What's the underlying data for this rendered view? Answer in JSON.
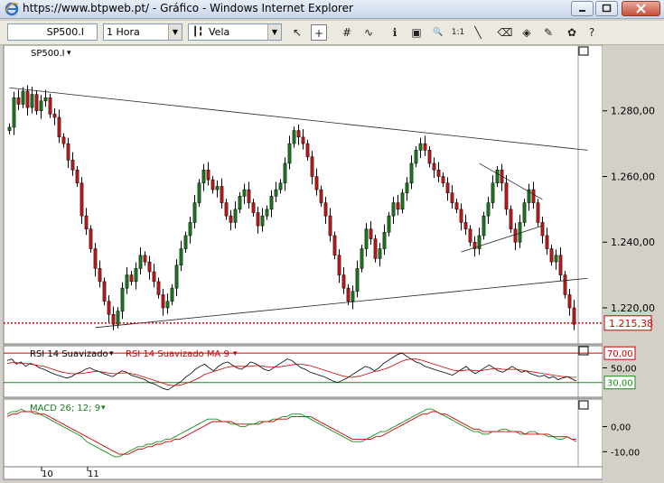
{
  "window": {
    "title": "https://www.btpweb.pt/ - Gráfico - Windows Internet Explorer"
  },
  "toolbar": {
    "symbol": "SP500.I",
    "interval": "1 Hora",
    "chart_style": "Vela",
    "tools": [
      {
        "name": "pointer-tool-icon",
        "glyph": "↖"
      },
      {
        "name": "crosshair-tool-icon",
        "glyph": "+"
      },
      {
        "name": "grid-tool-icon",
        "glyph": "#"
      },
      {
        "name": "indicator-tool-icon",
        "glyph": "∿"
      },
      {
        "name": "info-tool-icon",
        "glyph": "ℹ"
      },
      {
        "name": "chart-window-icon",
        "glyph": "▣"
      },
      {
        "name": "zoom-tool-icon",
        "glyph": "🔍"
      },
      {
        "name": "reset-zoom-icon",
        "glyph": "1:1"
      },
      {
        "name": "trendline-tool-icon",
        "glyph": "╲"
      },
      {
        "name": "eraser-tool-icon",
        "glyph": "⌫"
      },
      {
        "name": "fill-tool-icon",
        "glyph": "◈"
      },
      {
        "name": "magic-tool-icon",
        "glyph": "✎"
      },
      {
        "name": "palette-tool-icon",
        "glyph": "✿"
      },
      {
        "name": "help-icon",
        "glyph": "?"
      }
    ]
  },
  "colors": {
    "up_candle": "#1a7a1a",
    "down_candle": "#c01818",
    "support_line": "#cc0000",
    "rsi_line": "#000000",
    "rsi_ma_line": "#cc0000",
    "macd_line": "#1a8a1a",
    "signal_line": "#cc0000"
  },
  "chart_data": [
    {
      "type": "candlestick",
      "legend": "SP500.I",
      "y_ticks": [
        "1.280,00",
        "1.260,00",
        "1.240,00",
        "1.220,00"
      ],
      "ylim": [
        1209,
        1300
      ],
      "last_price_label": "1.215,38",
      "last_price": 1215.38,
      "x_ticks": [
        "10",
        "11"
      ],
      "close_path": [
        1275,
        1284,
        1282,
        1286,
        1281,
        1285,
        1280,
        1283,
        1284,
        1279,
        1278,
        1272,
        1270,
        1265,
        1262,
        1258,
        1248,
        1244,
        1238,
        1232,
        1228,
        1222,
        1218,
        1215,
        1219,
        1226,
        1230,
        1228,
        1232,
        1236,
        1234,
        1231,
        1228,
        1224,
        1220,
        1222,
        1226,
        1233,
        1238,
        1242,
        1246,
        1252,
        1258,
        1262,
        1259,
        1256,
        1257,
        1252,
        1248,
        1246,
        1250,
        1254,
        1256,
        1252,
        1249,
        1245,
        1248,
        1250,
        1254,
        1256,
        1258,
        1264,
        1270,
        1274,
        1272,
        1270,
        1266,
        1260,
        1256,
        1252,
        1248,
        1242,
        1236,
        1230,
        1226,
        1222,
        1225,
        1232,
        1238,
        1244,
        1241,
        1235,
        1238,
        1243,
        1248,
        1252,
        1250,
        1255,
        1258,
        1264,
        1268,
        1270,
        1268,
        1264,
        1262,
        1260,
        1258,
        1255,
        1252,
        1250,
        1246,
        1244,
        1240,
        1238,
        1242,
        1248,
        1252,
        1258,
        1262,
        1258,
        1250,
        1244,
        1240,
        1246,
        1252,
        1256,
        1252,
        1246,
        1242,
        1238,
        1234,
        1236,
        1230,
        1224,
        1220,
        1215
      ],
      "trendlines": [
        {
          "name": "upper-resistance",
          "from": [
            0,
            1287
          ],
          "to": [
            126,
            1268
          ]
        },
        {
          "name": "lower-support",
          "from": [
            19,
            1214
          ],
          "to": [
            126,
            1229
          ]
        },
        {
          "name": "wedge-upper",
          "from": [
            104,
            1264
          ],
          "to": [
            116,
            1253
          ]
        },
        {
          "name": "wedge-lower",
          "from": [
            100,
            1237
          ],
          "to": [
            116,
            1245
          ]
        }
      ]
    },
    {
      "type": "line",
      "legend_primary": "RSI 14 Suavizado",
      "legend_secondary": "RSI 14 Suavizado MA 9",
      "levels": [
        "70,00",
        "50,00",
        "30,00"
      ],
      "level_values": [
        70,
        50,
        30
      ],
      "ylim": [
        10,
        80
      ],
      "series": [
        {
          "values": [
            60,
            62,
            55,
            58,
            52,
            56,
            54,
            50,
            48,
            45,
            42,
            40,
            38,
            36,
            38,
            42,
            44,
            48,
            50,
            47,
            45,
            42,
            40,
            38,
            42,
            46,
            44,
            40,
            38,
            36,
            34,
            30,
            28,
            25,
            22,
            20,
            24,
            28,
            32,
            38,
            42,
            48,
            52,
            55,
            50,
            46,
            52,
            56,
            58,
            54,
            50,
            48,
            52,
            58,
            56,
            52,
            48,
            46,
            50,
            54,
            58,
            62,
            60,
            55,
            50,
            48,
            44,
            42,
            40,
            38,
            35,
            32,
            30,
            33,
            36,
            40,
            44,
            48,
            52,
            50,
            46,
            50,
            56,
            60,
            64,
            68,
            70,
            66,
            62,
            58,
            56,
            52,
            50,
            48,
            46,
            44,
            42,
            40,
            44,
            48,
            52,
            46,
            42,
            46,
            50,
            54,
            50,
            46,
            44,
            48,
            52,
            48,
            44,
            46,
            42,
            40,
            38,
            40,
            36,
            38,
            34,
            36,
            38,
            35,
            32
          ]
        },
        {
          "values": [
            56,
            57,
            57,
            56,
            56,
            55,
            54,
            53,
            52,
            50,
            48,
            46,
            44,
            43,
            42,
            42,
            42,
            43,
            44,
            45,
            45,
            44,
            43,
            42,
            42,
            43,
            43,
            42,
            41,
            39,
            37,
            35,
            33,
            31,
            29,
            27,
            26,
            26,
            27,
            29,
            31,
            34,
            37,
            41,
            43,
            45,
            47,
            49,
            51,
            52,
            52,
            52,
            52,
            52,
            53,
            53,
            52,
            51,
            51,
            51,
            52,
            53,
            54,
            55,
            55,
            54,
            53,
            51,
            49,
            47,
            45,
            43,
            41,
            39,
            38,
            37,
            38,
            39,
            41,
            43,
            45,
            46,
            48,
            50,
            53,
            56,
            59,
            61,
            62,
            62,
            61,
            59,
            57,
            55,
            53,
            51,
            49,
            47,
            46,
            46,
            47,
            47,
            46,
            46,
            47,
            48,
            49,
            49,
            48,
            48,
            48,
            48,
            47,
            46,
            45,
            44,
            43,
            42,
            41,
            40,
            39,
            38,
            38,
            37,
            37
          ]
        }
      ]
    },
    {
      "type": "line",
      "legend": "MACD 26; 12; 9",
      "y_ticks": [
        "0,00",
        "-10,00"
      ],
      "tick_values": [
        0,
        -10
      ],
      "ylim": [
        -16,
        11
      ],
      "series": [
        {
          "values": [
            5,
            6,
            6,
            7,
            6,
            6,
            5,
            5,
            4,
            3,
            2,
            1,
            0,
            -1,
            -2,
            -3,
            -4,
            -6,
            -7,
            -8,
            -9,
            -10,
            -11,
            -12,
            -12,
            -11,
            -10,
            -9,
            -8,
            -8,
            -7,
            -7,
            -6,
            -6,
            -5,
            -5,
            -4,
            -3,
            -2,
            -1,
            0,
            1,
            2,
            3,
            3,
            3,
            2,
            2,
            1,
            1,
            0,
            0,
            1,
            1,
            2,
            2,
            2,
            3,
            3,
            4,
            4,
            5,
            5,
            5,
            4,
            3,
            2,
            1,
            0,
            -1,
            -2,
            -3,
            -4,
            -5,
            -6,
            -6,
            -6,
            -5,
            -4,
            -3,
            -2,
            -2,
            -1,
            0,
            1,
            2,
            3,
            4,
            5,
            6,
            7,
            7,
            6,
            5,
            4,
            3,
            2,
            1,
            0,
            -1,
            -2,
            -2,
            -3,
            -3,
            -2,
            -2,
            -1,
            -1,
            -2,
            -2,
            -3,
            -3,
            -2,
            -2,
            -3,
            -3,
            -4,
            -4,
            -5,
            -5,
            -4,
            -5,
            -6
          ]
        },
        {
          "values": [
            4,
            5,
            5,
            6,
            6,
            6,
            6,
            5,
            5,
            4,
            3,
            2,
            1,
            0,
            -1,
            -2,
            -3,
            -4,
            -5,
            -6,
            -7,
            -8,
            -9,
            -10,
            -11,
            -11,
            -11,
            -10,
            -9,
            -9,
            -8,
            -8,
            -7,
            -7,
            -6,
            -6,
            -5,
            -5,
            -4,
            -3,
            -2,
            -1,
            0,
            1,
            2,
            2,
            2,
            2,
            2,
            1,
            1,
            1,
            1,
            1,
            1,
            2,
            2,
            2,
            3,
            3,
            3,
            4,
            4,
            4,
            4,
            4,
            3,
            2,
            1,
            0,
            -1,
            -2,
            -3,
            -4,
            -5,
            -5,
            -5,
            -5,
            -5,
            -4,
            -4,
            -3,
            -2,
            -1,
            0,
            1,
            2,
            3,
            4,
            5,
            5,
            6,
            6,
            5,
            5,
            4,
            3,
            2,
            1,
            0,
            -1,
            -1,
            -2,
            -2,
            -2,
            -2,
            -2,
            -2,
            -2,
            -2,
            -2,
            -3,
            -3,
            -3,
            -3,
            -3,
            -3,
            -4,
            -4,
            -4,
            -4,
            -5,
            -5
          ]
        }
      ]
    }
  ]
}
